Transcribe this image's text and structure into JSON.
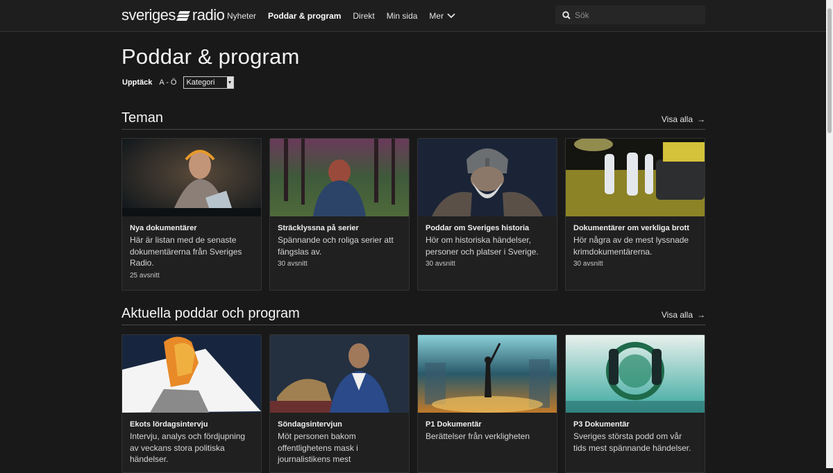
{
  "header": {
    "logo_left": "sveriges",
    "logo_right": "radio",
    "nav": [
      "Nyheter",
      "Poddar & program",
      "Direkt",
      "Min sida",
      "Mer"
    ],
    "search_placeholder": "Sök"
  },
  "page": {
    "title": "Poddar & program",
    "filters": {
      "discover": "Upptäck",
      "az": "A - Ö",
      "category": "Kategori"
    }
  },
  "sections": [
    {
      "title": "Teman",
      "see_all": "Visa alla",
      "cards": [
        {
          "title": "Nya dokumentärer",
          "desc": "Här är listan med de senaste dokumentärerna från Sveriges Radio.",
          "count": "25 avsnitt"
        },
        {
          "title": "Sträcklyssna på serier",
          "desc": "Spännande och roliga serier att fängslas av.",
          "count": "30 avsnitt"
        },
        {
          "title": "Poddar om Sveriges historia",
          "desc": "Hör om historiska händelser, personer och platser i Sverige.",
          "count": "30 avsnitt"
        },
        {
          "title": "Dokumentärer om verkliga brott",
          "desc": "Hör några av de mest lyssnade krimdokumentärerna.",
          "count": "30 avsnitt"
        }
      ]
    },
    {
      "title": "Aktuella poddar och program",
      "see_all": "Visa alla",
      "cards": [
        {
          "title": "Ekots lördagsintervju",
          "desc": "Intervju, analys och fördjupning av veckans stora politiska händelser."
        },
        {
          "title": "Söndagsintervjun",
          "desc": "Möt personen bakom offentlighetens mask i journalistikens mest"
        },
        {
          "title": "P1 Dokumentär",
          "desc": "Berättelser från verkligheten"
        },
        {
          "title": "P3 Dokumentär",
          "desc": "Sveriges största podd om vår tids mest spännande händelser."
        }
      ]
    }
  ],
  "colors": {
    "background": "#191919",
    "header": "#1e1e1e",
    "card": "#202020",
    "text": "#ececec"
  }
}
